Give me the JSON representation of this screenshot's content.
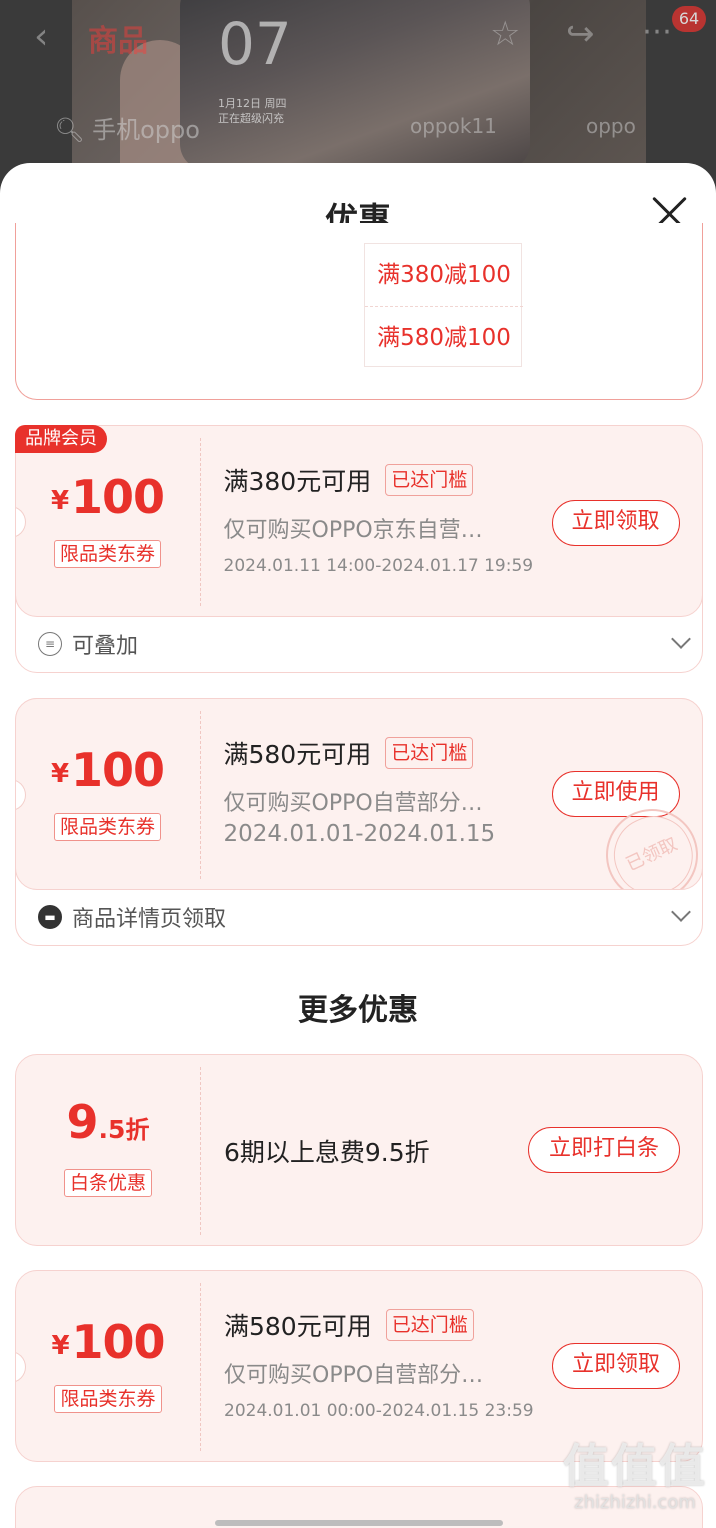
{
  "background": {
    "tab_label": "商品",
    "clock": "07",
    "date_line1": "1月12日 周四",
    "date_line2": "正在超级闪充",
    "search_text": "手机oppo",
    "hint1": "oppok11",
    "hint2": "oppo",
    "cart_badge": "64"
  },
  "sheet": {
    "title": "优惠",
    "tiers": [
      "满380减100",
      "满580减100"
    ]
  },
  "coupons": [
    {
      "brand_badge": "品牌会员",
      "currency": "¥",
      "amount": "100",
      "type": "限品类东券",
      "condition": "满380元可用",
      "reached": "已达门槛",
      "scope": "仅可购买OPPO京东自营…",
      "validity": "2024.01.11 14:00-2024.01.17 19:59",
      "action": "立即领取",
      "footer": "可叠加"
    },
    {
      "currency": "¥",
      "amount": "100",
      "type": "限品类东券",
      "condition": "满580元可用",
      "reached": "已达门槛",
      "scope": "仅可购买OPPO自营部分…",
      "validity": "2024.01.01-2024.01.15",
      "action": "立即使用",
      "stamp": "已领取",
      "footer": "商品详情页领取"
    }
  ],
  "more": {
    "title": "更多优惠",
    "baitiao": {
      "int": "9",
      "dec": ".5",
      "unit": "折",
      "type": "白条优惠",
      "text": "6期以上息费9.5折",
      "action": "立即打白条"
    },
    "coupon3": {
      "currency": "¥",
      "amount": "100",
      "type": "限品类东券",
      "condition": "满580元可用",
      "reached": "已达门槛",
      "scope": "仅可购买OPPO自营部分…",
      "validity": "2024.01.01 00:00-2024.01.15 23:59",
      "action": "立即领取"
    }
  },
  "watermark": {
    "big": "值值值",
    "small": "zhizhizhi.com"
  },
  "colors": {
    "accent": "#e8312b",
    "card_bg": "#fdf1ef",
    "card_border": "#f6d2cf"
  }
}
